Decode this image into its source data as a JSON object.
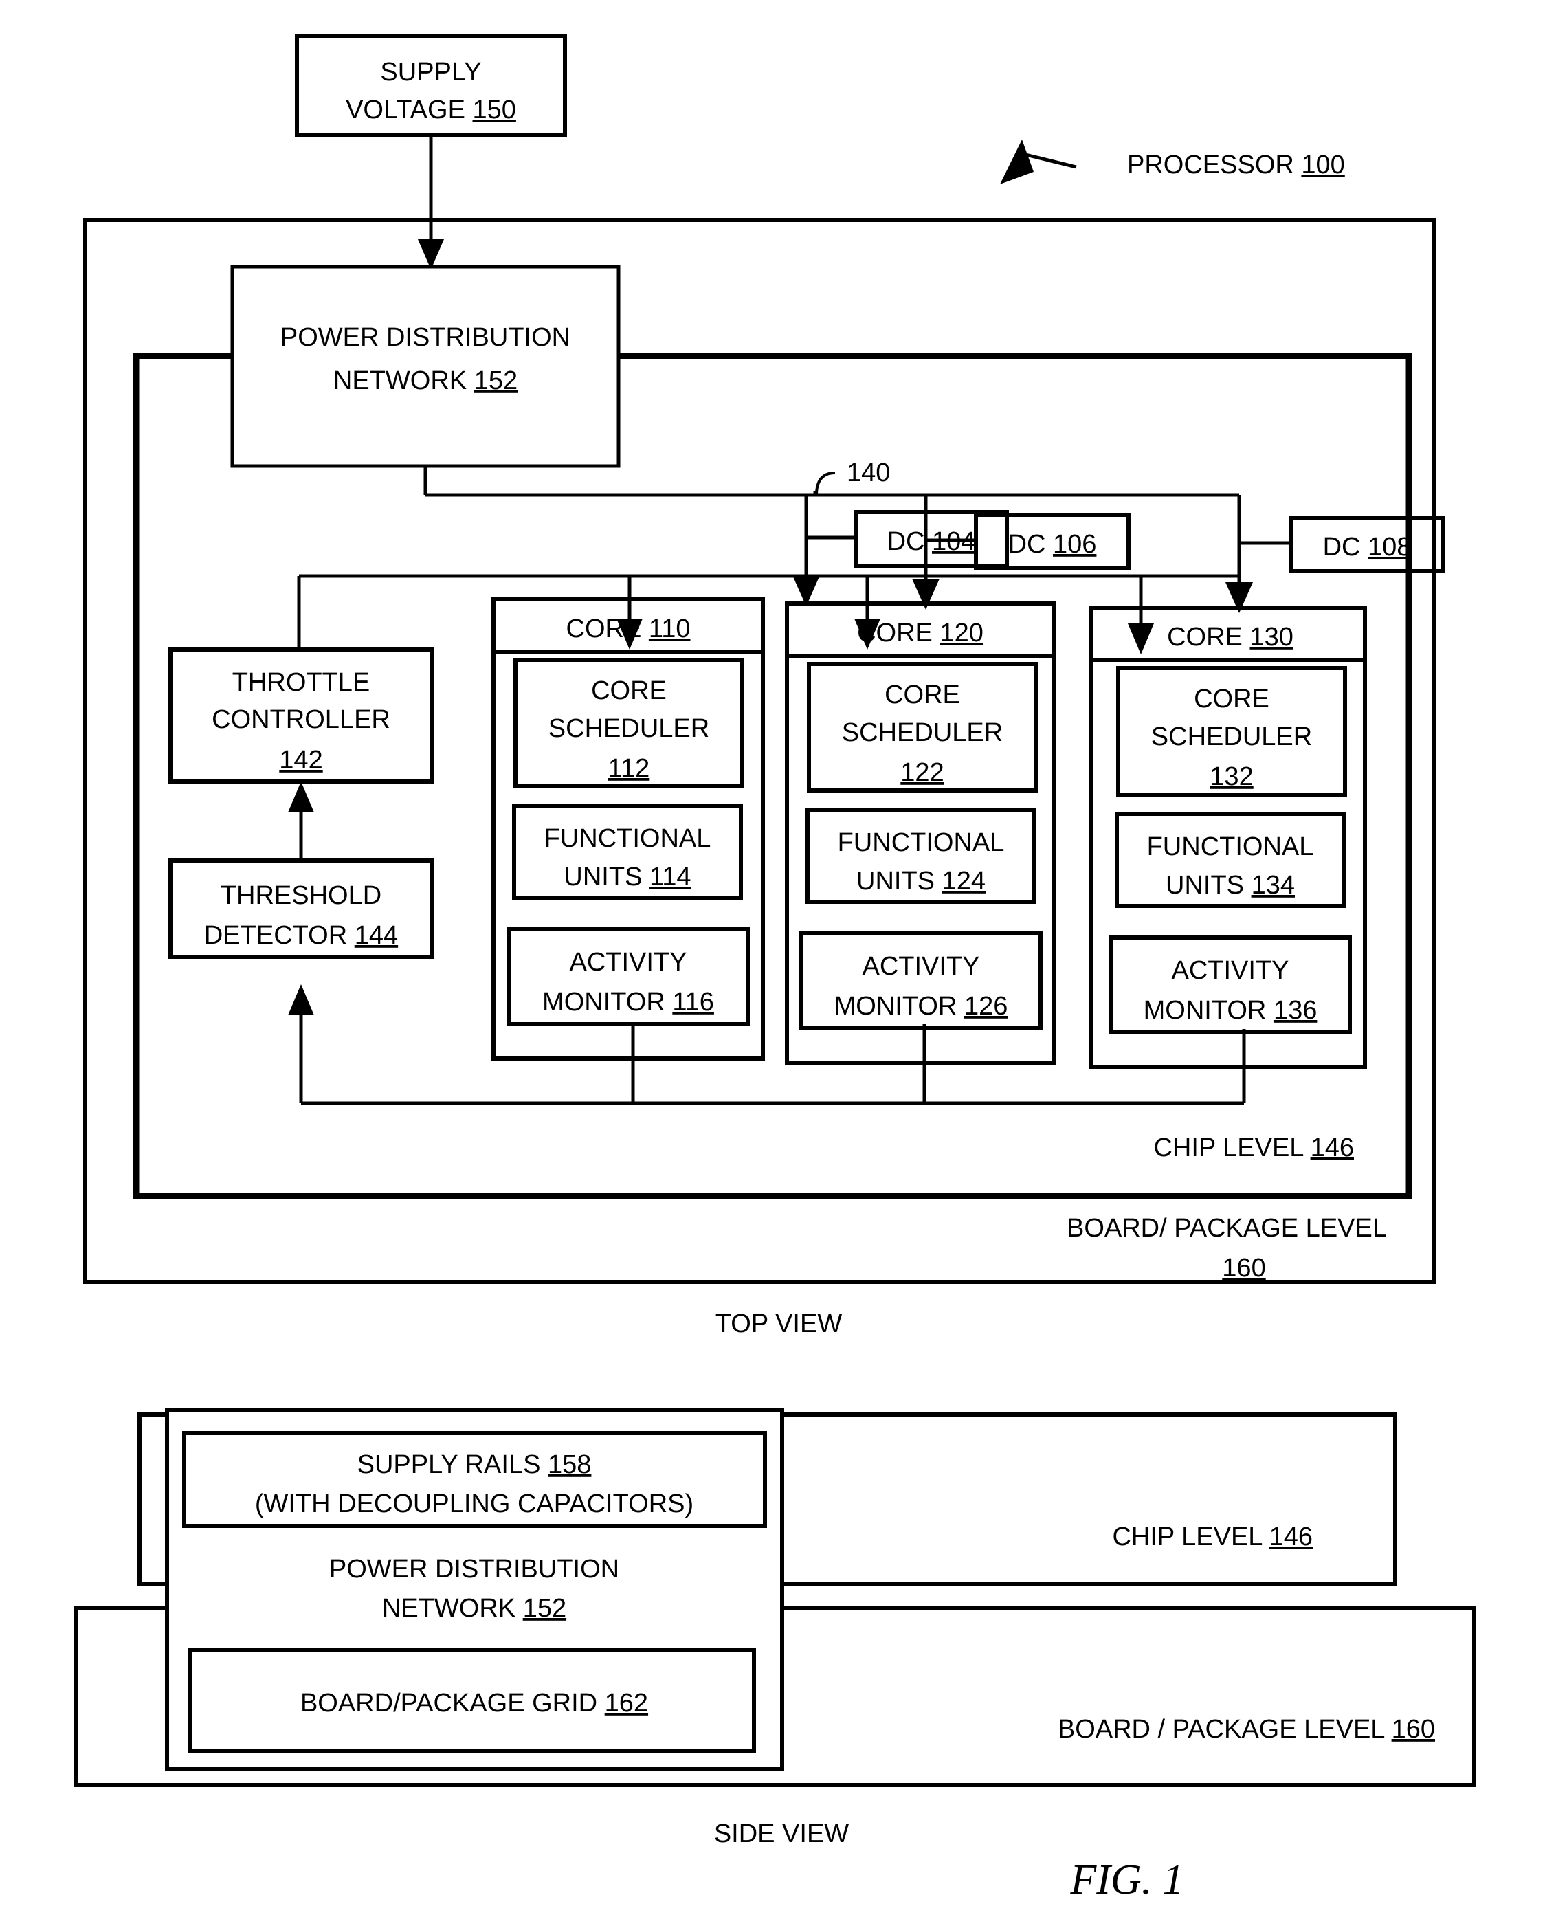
{
  "figure": {
    "caption": "FIG. 1",
    "top_view_label": "TOP VIEW",
    "side_view_label": "SIDE VIEW"
  },
  "top_view": {
    "supply_voltage": {
      "line1": "SUPPLY",
      "line2_text": "VOLTAGE ",
      "line2_ref": "150"
    },
    "processor_callout": {
      "text": "PROCESSOR ",
      "ref": "100"
    },
    "power_distribution_network": {
      "line1": "POWER DISTRIBUTION",
      "line2_text": "NETWORK ",
      "line2_ref": "152"
    },
    "bus_label": "140",
    "decoupling_capacitors": [
      {
        "text": "DC ",
        "ref": "104"
      },
      {
        "text": "DC ",
        "ref": "106"
      },
      {
        "text": "DC ",
        "ref": "108"
      }
    ],
    "throttle_controller": {
      "line1": "THROTTLE",
      "line2": "CONTROLLER",
      "line3_ref": "142"
    },
    "threshold_detector": {
      "line1": "THRESHOLD",
      "line2_text": "DETECTOR ",
      "line2_ref": "144"
    },
    "cores": [
      {
        "title_text": "CORE ",
        "title_ref": "110",
        "scheduler": {
          "line1": "CORE",
          "line2": "SCHEDULER",
          "line3_ref": "112"
        },
        "functional_units": {
          "line1": "FUNCTIONAL",
          "line2_text": "UNITS ",
          "line2_ref": "114"
        },
        "activity_monitor": {
          "line1": "ACTIVITY",
          "line2_text": "MONITOR ",
          "line2_ref": "116"
        }
      },
      {
        "title_text": "CORE ",
        "title_ref": "120",
        "scheduler": {
          "line1": "CORE",
          "line2": "SCHEDULER",
          "line3_ref": "122"
        },
        "functional_units": {
          "line1": "FUNCTIONAL",
          "line2_text": "UNITS ",
          "line2_ref": "124"
        },
        "activity_monitor": {
          "line1": "ACTIVITY",
          "line2_text": "MONITOR ",
          "line2_ref": "126"
        }
      },
      {
        "title_text": "CORE ",
        "title_ref": "130",
        "scheduler": {
          "line1": "CORE",
          "line2": "SCHEDULER",
          "line3_ref": "132"
        },
        "functional_units": {
          "line1": "FUNCTIONAL",
          "line2_text": "UNITS ",
          "line2_ref": "134"
        },
        "activity_monitor": {
          "line1": "ACTIVITY",
          "line2_text": "MONITOR ",
          "line2_ref": "136"
        }
      }
    ],
    "chip_level": {
      "text": "CHIP LEVEL ",
      "ref": "146"
    },
    "board_level": {
      "line1": "BOARD/ PACKAGE LEVEL",
      "line2_ref": "160"
    }
  },
  "side_view": {
    "supply_rails": {
      "line1_text": "SUPPLY RAILS ",
      "line1_ref": "158",
      "line2": "(WITH DECOUPLING CAPACITORS)"
    },
    "power_distribution_network": {
      "line1": "POWER DISTRIBUTION",
      "line2_text": "NETWORK ",
      "line2_ref": "152"
    },
    "board_package_grid": {
      "text": "BOARD/PACKAGE  GRID ",
      "ref": "162"
    },
    "chip_level": {
      "text": "CHIP LEVEL ",
      "ref": "146"
    },
    "board_level": {
      "text": "BOARD / PACKAGE LEVEL ",
      "ref": "160"
    }
  },
  "colors": {
    "ink": "#000000",
    "paper": "#ffffff"
  }
}
